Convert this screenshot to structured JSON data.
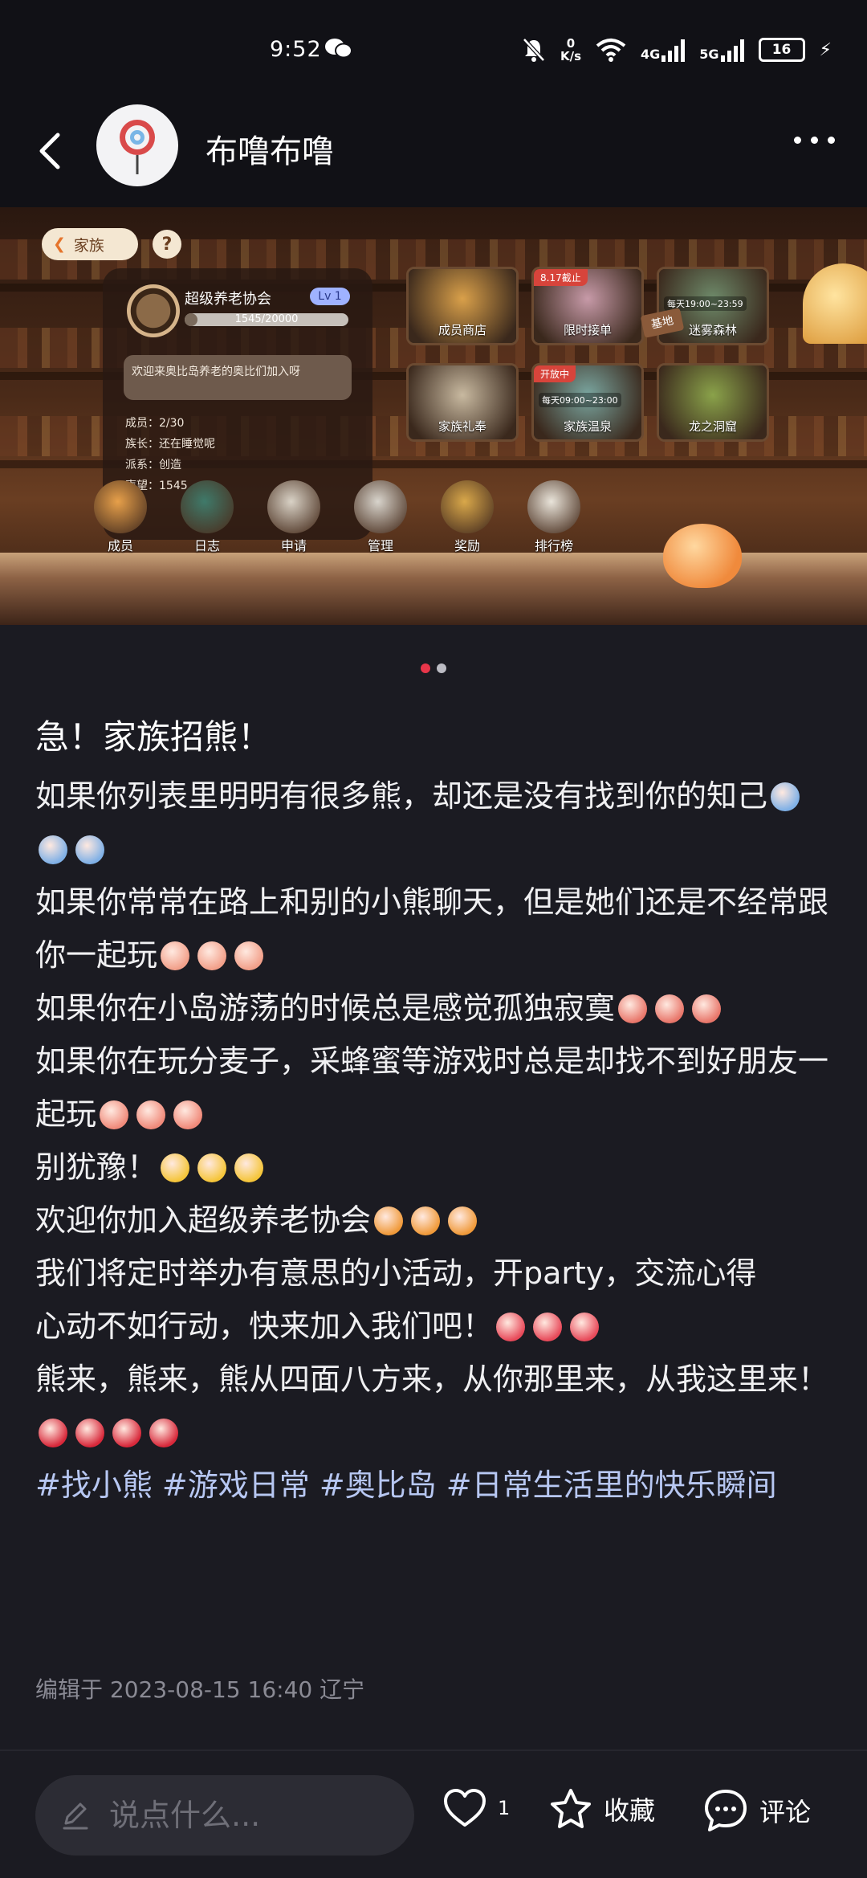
{
  "status_bar": {
    "time": "9:52",
    "net_speed_value": "0",
    "net_speed_unit": "K/s",
    "signal_1": "4G",
    "signal_2": "5G",
    "battery": "16"
  },
  "header": {
    "author": "布噜布噜"
  },
  "banner": {
    "family_tag": "家族",
    "help": "?",
    "guild_name": "超级养老协会",
    "level": "Lv 1",
    "progress_text": "1545/20000",
    "progress_fraction": 0.077,
    "welcome_msg": "欢迎来奥比岛养老的奥比们加入呀",
    "info": {
      "members": "成员：2/30",
      "leader": "族长：还在睡觉呢",
      "faction": "派系：创造",
      "prestige": "声望：1545"
    },
    "cards": [
      {
        "label": "成员商店",
        "chip": ""
      },
      {
        "label": "限时接单",
        "chip": "8.17截止"
      },
      {
        "label": "迷雾森林",
        "chip": "",
        "time": "每天19:00~23:59"
      },
      {
        "label": "家族礼奉",
        "chip": ""
      },
      {
        "label": "家族温泉",
        "chip": "开放中",
        "time": "每天09:00~23:00"
      },
      {
        "label": "龙之洞窟",
        "chip": ""
      }
    ],
    "icons": [
      {
        "label": "成员",
        "color": "#e7a04a"
      },
      {
        "label": "日志",
        "color": "#3f7a6a"
      },
      {
        "label": "申请",
        "color": "#d9d2c6"
      },
      {
        "label": "管理",
        "color": "#d8d4cc"
      },
      {
        "label": "奖励",
        "color": "#d9a84a"
      },
      {
        "label": "排行榜",
        "color": "#e9e4da"
      }
    ],
    "signpost": "基地"
  },
  "carousel": {
    "active_color": "#e8364a",
    "inactive_color": "#bcbcc4"
  },
  "post": {
    "title": "急！家族招熊！",
    "lines": [
      {
        "text": "如果你列表里明明有很多熊，却还是没有找到你的知己",
        "emoji": "crying-face-emoji",
        "emoji_count": 3,
        "emoji_color": "#7fb0e6"
      },
      {
        "text": "如果你常常在路上和别的小熊聊天，但是她们还是不经常跟你一起玩",
        "emoji": "sad-face-emoji",
        "emoji_count": 3,
        "emoji_color": "#f2a08a"
      },
      {
        "text": "如果你在小岛游荡的时候总是感觉孤独寂寞",
        "emoji": "lonely-face-emoji",
        "emoji_count": 3,
        "emoji_color": "#e8766a"
      },
      {
        "text": "如果你在玩分麦子，采蜂蜜等游戏时总是却找不到好朋友一起玩",
        "emoji": "sobbing-face-emoji",
        "emoji_count": 3,
        "emoji_color": "#f08a7a"
      },
      {
        "text": "别犹豫！",
        "emoji": "sparkle-emoji",
        "emoji_count": 3,
        "emoji_color": "#f5c53a"
      },
      {
        "text": "欢迎你加入超级养老协会",
        "emoji": "firework-emoji",
        "emoji_count": 3,
        "emoji_color": "#f09a3a"
      },
      {
        "text": "我们将定时举办有意思的小活动，开party，交流心得",
        "emoji": "",
        "emoji_count": 0,
        "emoji_color": ""
      },
      {
        "text": "心动不如行动，快来加入我们吧！",
        "emoji": "party-popper-emoji",
        "emoji_count": 3,
        "emoji_color": "#e84a5a"
      },
      {
        "text": "熊来，熊来，熊从四面八方来，从你那里来，从我这里来！",
        "emoji": "rose-emoji",
        "emoji_count": 4,
        "emoji_color": "#d8283a"
      }
    ],
    "tags": "#找小熊 #游戏日常 #奥比岛 #日常生活里的快乐瞬间",
    "edited": "编辑于 2023-08-15 16:40 辽宁"
  },
  "bottom_bar": {
    "comment_placeholder": "说点什么...",
    "like_count": "1",
    "favorite_label": "收藏",
    "comment_label": "评论"
  }
}
